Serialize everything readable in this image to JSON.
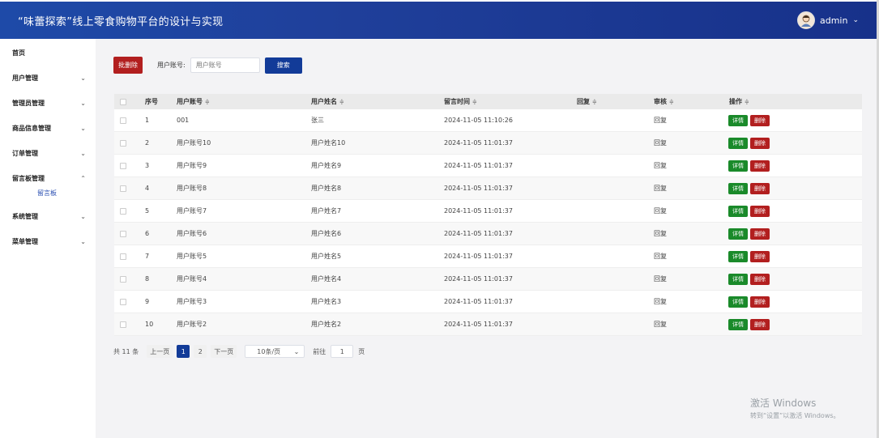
{
  "header": {
    "title": "“味蕾探索”线上零食购物平台的设计与实现",
    "username": "admin"
  },
  "sidebar": {
    "items": [
      {
        "label": "首页",
        "chevron": ""
      },
      {
        "label": "用户管理",
        "chevron": "⌄"
      },
      {
        "label": "管理员管理",
        "chevron": "⌄"
      },
      {
        "label": "商品信息管理",
        "chevron": "⌄"
      },
      {
        "label": "订单管理",
        "chevron": "⌄"
      },
      {
        "label": "留言板管理",
        "chevron": "⌃"
      },
      {
        "label": "系统管理",
        "chevron": "⌄"
      },
      {
        "label": "菜单管理",
        "chevron": "⌄"
      }
    ],
    "sub_label": "留言板"
  },
  "toolbar": {
    "batch_delete_label": "批删除",
    "search_label": "用户账号:",
    "search_placeholder": "用户账号",
    "search_button": "搜索"
  },
  "table": {
    "headers": {
      "index": "序号",
      "account": "用户账号",
      "name": "用户姓名",
      "time": "留言时间",
      "reply": "回复",
      "audit": "审核",
      "ops": "操作"
    },
    "detail_label": "详情",
    "delete_label": "删除",
    "rows": [
      {
        "index": "1",
        "account": "001",
        "name": "张三",
        "time": "2024-11-05 11:10:26",
        "audit": "回复"
      },
      {
        "index": "2",
        "account": "用户账号10",
        "name": "用户姓名10",
        "time": "2024-11-05 11:01:37",
        "audit": "回复"
      },
      {
        "index": "3",
        "account": "用户账号9",
        "name": "用户姓名9",
        "time": "2024-11-05 11:01:37",
        "audit": "回复"
      },
      {
        "index": "4",
        "account": "用户账号8",
        "name": "用户姓名8",
        "time": "2024-11-05 11:01:37",
        "audit": "回复"
      },
      {
        "index": "5",
        "account": "用户账号7",
        "name": "用户姓名7",
        "time": "2024-11-05 11:01:37",
        "audit": "回复"
      },
      {
        "index": "6",
        "account": "用户账号6",
        "name": "用户姓名6",
        "time": "2024-11-05 11:01:37",
        "audit": "回复"
      },
      {
        "index": "7",
        "account": "用户账号5",
        "name": "用户姓名5",
        "time": "2024-11-05 11:01:37",
        "audit": "回复"
      },
      {
        "index": "8",
        "account": "用户账号4",
        "name": "用户姓名4",
        "time": "2024-11-05 11:01:37",
        "audit": "回复"
      },
      {
        "index": "9",
        "account": "用户账号3",
        "name": "用户姓名3",
        "time": "2024-11-05 11:01:37",
        "audit": "回复"
      },
      {
        "index": "10",
        "account": "用户账号2",
        "name": "用户姓名2",
        "time": "2024-11-05 11:01:37",
        "audit": "回复"
      }
    ]
  },
  "pager": {
    "total": "共 11 条",
    "prev": "上一页",
    "pages": [
      "1",
      "2"
    ],
    "next": "下一页",
    "page_size": "10条/页",
    "goto_label": "前往",
    "goto_value": "1",
    "page_unit": "页"
  },
  "watermark": {
    "line1": "激活 Windows",
    "line2": "转到“设置”以激活 Windows。"
  }
}
